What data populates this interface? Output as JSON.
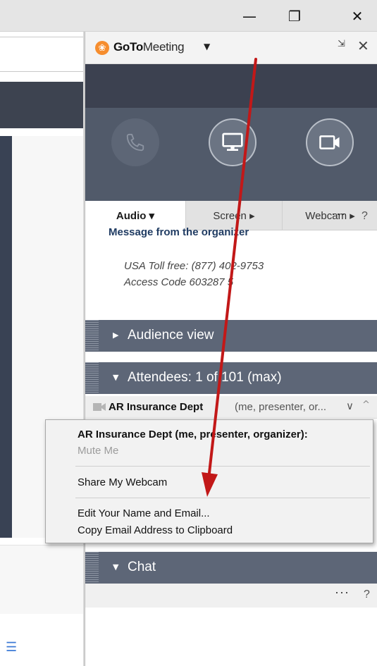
{
  "window": {
    "minimize_glyph": "—",
    "restore_glyph": "❐",
    "close_glyph": "✕"
  },
  "header": {
    "brand_bold": "GoTo",
    "brand_rest": "Meeting",
    "caret": "▼",
    "collapse_glyph": "⇲",
    "close_glyph": "✕"
  },
  "controls": {
    "audio_icon": "phone-icon",
    "screen_icon": "monitor-icon",
    "webcam_icon": "video-camera-icon"
  },
  "tabs": [
    {
      "label": "Audio ▾"
    },
    {
      "label": "Screen ▸"
    },
    {
      "label": "Webcam ▸"
    }
  ],
  "audio_panel": {
    "more": "···",
    "help": "?",
    "message_title": "Message from the organizer",
    "lines": [
      "USA Toll free: (877) 402-9753",
      "Access Code 603287 5"
    ]
  },
  "sections": {
    "audience_view": "Audience view",
    "attendees": "Attendees:  1 of 101 (max)",
    "chat": "Chat"
  },
  "attendee": {
    "name": "AR Insurance Dept",
    "roles": "(me, presenter, or...",
    "chevron": "∨",
    "up": "^"
  },
  "context_menu": {
    "header": "AR Insurance Dept (me, presenter, organizer):",
    "items": [
      "Mute Me",
      "Share My Webcam",
      "Edit Your Name and Email...",
      "Copy Email Address to Clipboard"
    ]
  },
  "bottom": {
    "more": "···",
    "help": "?"
  },
  "colors": {
    "accent_orange": "#f68d2e",
    "panel_dark": "#3c4150",
    "section_bar": "#5d6677",
    "annotation_red": "#c21818"
  }
}
